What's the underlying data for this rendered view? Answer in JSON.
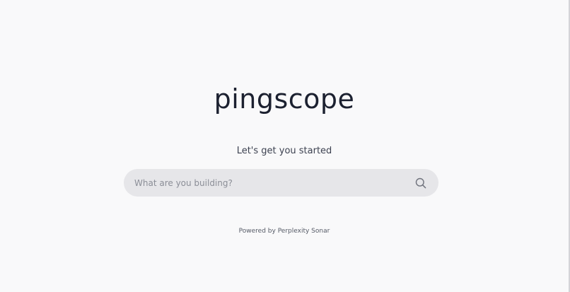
{
  "brand": {
    "name": "pingscope"
  },
  "hero": {
    "subtitle": "Let's get you started"
  },
  "search": {
    "placeholder": "What are you building?",
    "value": "",
    "icon": "search-icon"
  },
  "footer": {
    "powered_by": "Powered by Perplexity Sonar"
  },
  "colors": {
    "background": "#f9f9fa",
    "search_background": "#e6e6e9",
    "text": "#1c2130"
  }
}
